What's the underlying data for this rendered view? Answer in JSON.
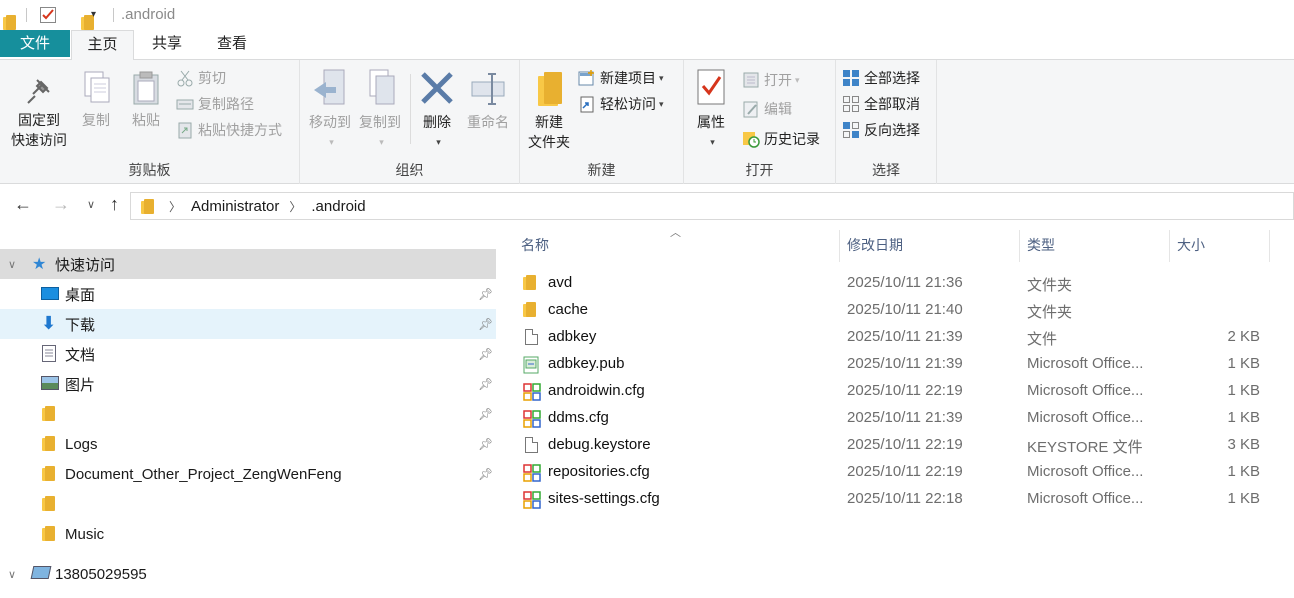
{
  "window": {
    "title": ".android"
  },
  "tabs": {
    "file": "文件",
    "home": "主页",
    "share": "共享",
    "view": "查看"
  },
  "ribbon": {
    "clipboard": {
      "label": "剪贴板",
      "pin_line1": "固定到",
      "pin_line2": "快速访问",
      "copy": "复制",
      "paste": "粘贴",
      "cut": "剪切",
      "copy_path": "复制路径",
      "paste_shortcut": "粘贴快捷方式"
    },
    "organize": {
      "label": "组织",
      "move_to": "移动到",
      "copy_to": "复制到",
      "delete": "删除",
      "rename": "重命名"
    },
    "new": {
      "label": "新建",
      "new_folder_line1": "新建",
      "new_folder_line2": "文件夹",
      "new_item": "新建项目",
      "easy_access": "轻松访问"
    },
    "open": {
      "label": "打开",
      "properties": "属性",
      "open": "打开",
      "edit": "编辑",
      "history": "历史记录"
    },
    "select": {
      "label": "选择",
      "select_all": "全部选择",
      "select_none": "全部取消",
      "invert": "反向选择"
    }
  },
  "address": {
    "crumbs": [
      "Administrator",
      ".android"
    ]
  },
  "nav": {
    "quick_access": "快速访问",
    "items": [
      {
        "label": "桌面",
        "icon": "desktop-icon"
      },
      {
        "label": "下载",
        "icon": "download-icon"
      },
      {
        "label": "文档",
        "icon": "documents-icon"
      },
      {
        "label": "图片",
        "icon": "pictures-icon"
      },
      {
        "label": "",
        "icon": "folder-icon"
      },
      {
        "label": "Logs",
        "icon": "folder-icon"
      },
      {
        "label": "Document_Other_Project_ZengWenFeng",
        "icon": "folder-icon"
      },
      {
        "label": "",
        "icon": "folder-icon"
      },
      {
        "label": "Music",
        "icon": "folder-icon"
      }
    ],
    "this_pc": "13805029595"
  },
  "filelist": {
    "headers": {
      "name": "名称",
      "modified": "修改日期",
      "type": "类型",
      "size": "大小"
    },
    "rows": [
      {
        "name": "avd",
        "modified": "2025/10/11 21:36",
        "type": "文件夹",
        "size": "",
        "icon": "folder"
      },
      {
        "name": "cache",
        "modified": "2025/10/11 21:40",
        "type": "文件夹",
        "size": "",
        "icon": "folder"
      },
      {
        "name": "adbkey",
        "modified": "2025/10/11 21:39",
        "type": "文件",
        "size": "2 KB",
        "icon": "doc"
      },
      {
        "name": "adbkey.pub",
        "modified": "2025/10/11 21:39",
        "type": "Microsoft Office...",
        "size": "1 KB",
        "icon": "pub"
      },
      {
        "name": "androidwin.cfg",
        "modified": "2025/10/11 22:19",
        "type": "Microsoft Office...",
        "size": "1 KB",
        "icon": "cfg"
      },
      {
        "name": "ddms.cfg",
        "modified": "2025/10/11 21:39",
        "type": "Microsoft Office...",
        "size": "1 KB",
        "icon": "cfg"
      },
      {
        "name": "debug.keystore",
        "modified": "2025/10/11 22:19",
        "type": "KEYSTORE 文件",
        "size": "3 KB",
        "icon": "doc"
      },
      {
        "name": "repositories.cfg",
        "modified": "2025/10/11 22:19",
        "type": "Microsoft Office...",
        "size": "1 KB",
        "icon": "cfg"
      },
      {
        "name": "sites-settings.cfg",
        "modified": "2025/10/11 22:18",
        "type": "Microsoft Office...",
        "size": "1 KB",
        "icon": "cfg"
      }
    ]
  }
}
